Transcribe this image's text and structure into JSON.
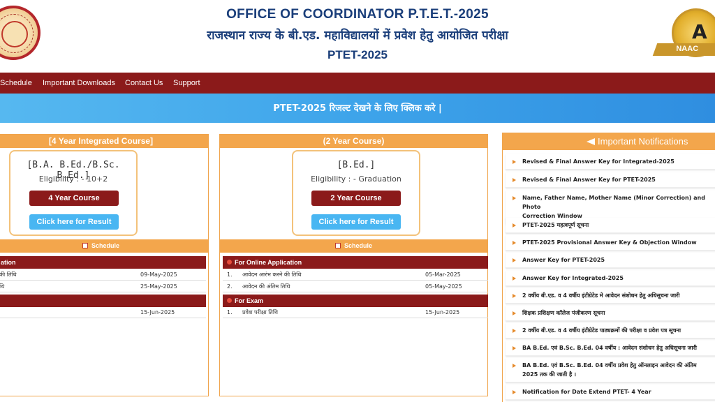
{
  "header": {
    "title_en": "OFFICE OF COORDINATOR P.T.E.T.-2025",
    "title_hi": "राजस्थान राज्य के बी.एड. महाविद्यालयों में प्रवेश हेतु आयोजित परीक्षा",
    "subtitle": "PTET-2025",
    "naac_letter": "A",
    "naac_label": "NAAC"
  },
  "nav": {
    "items": [
      "Schedule",
      "Important Downloads",
      "Contact Us",
      "Support"
    ]
  },
  "banner": {
    "text": "PTET-2025 रिजल्ट देखने के लिए क्लिक करे |"
  },
  "courses": [
    {
      "header": "[4 Year Integrated Course]",
      "name": "[B.A. B.Ed./B.Sc. B.Ed.]",
      "eligibility": "Eligibility : - 10+2",
      "course_button": "4 Year Course",
      "result_button": "Click here for Result",
      "schedule_label": "Schedule",
      "sections": [
        {
          "title": "ation",
          "rows": [
            {
              "n": "",
              "text": "की तिथि",
              "date": "09-May-2025"
            },
            {
              "n": "",
              "text": "थि",
              "date": "25-May-2025"
            }
          ]
        },
        {
          "title": "",
          "rows": [
            {
              "n": "",
              "text": "",
              "date": "15-Jun-2025"
            }
          ]
        }
      ]
    },
    {
      "header": "(2 Year Course)",
      "name": "[B.Ed.]",
      "eligibility": "Eligibility : - Graduation",
      "course_button": "2 Year Course",
      "result_button": "Click here for Result",
      "schedule_label": "Schedule",
      "sections": [
        {
          "title": "For Online Application",
          "rows": [
            {
              "n": "1.",
              "text": "आवेदन आरंभ करने की तिथि",
              "date": "05-Mar-2025"
            },
            {
              "n": "2.",
              "text": "आवेदन की अंतिम तिथि",
              "date": "05-May-2025"
            }
          ]
        },
        {
          "title": "For Exam",
          "rows": [
            {
              "n": "1.",
              "text": "प्रवेश परीक्षा तिथि",
              "date": "15-Jun-2025"
            }
          ]
        }
      ]
    }
  ],
  "notifications": {
    "title": "Important Notifications",
    "items": [
      "Revised & Final Answer Key for Integrated-2025",
      "Revised & Final Answer Key for PTET-2025",
      "Name, Father Name, Mother Name (Minor Correction) and Photo",
      "Correction Window",
      "PTET-2025 महत्वपूर्ण सूचना",
      "PTET-2025 Provisional Answer Key & Objection Window",
      "Answer Key for PTET-2025",
      "Answer Key for Integrated-2025",
      "2 वर्षीय बी.एड. व 4 वर्षीय इंटीग्रेटेड मे आवेदन संशोधन हेतु अधिसूचना जारी",
      "शिक्षक प्रशिक्षण कॉलेज पंजीकरण सूचना",
      "2 वर्षीय बी.एड. व 4 वर्षीय इंटीग्रेटेड पाठ्यक्रमों की परीक्षा व प्रवेश पत्र सूचना",
      "BA B.Ed. एवं B.Sc. B.Ed. 04 वर्षीय : आवेदन संशोधन हेतु अधिसूचना जारी",
      "BA B.Ed. एवं B.Sc. B.Ed. 04 वर्षीय प्रवेश हेतु ऑनलाइन आवेदन की अंतिम",
      "2025 तक की जाती है ।",
      "Notification for Date Extend PTET- 4 Year"
    ]
  },
  "colors": {
    "primary": "#1a3e7a",
    "nav": "#8b1a1a",
    "accent": "#f3a64c",
    "banner": "#3ea4ea",
    "result_button": "#49b6f2"
  }
}
